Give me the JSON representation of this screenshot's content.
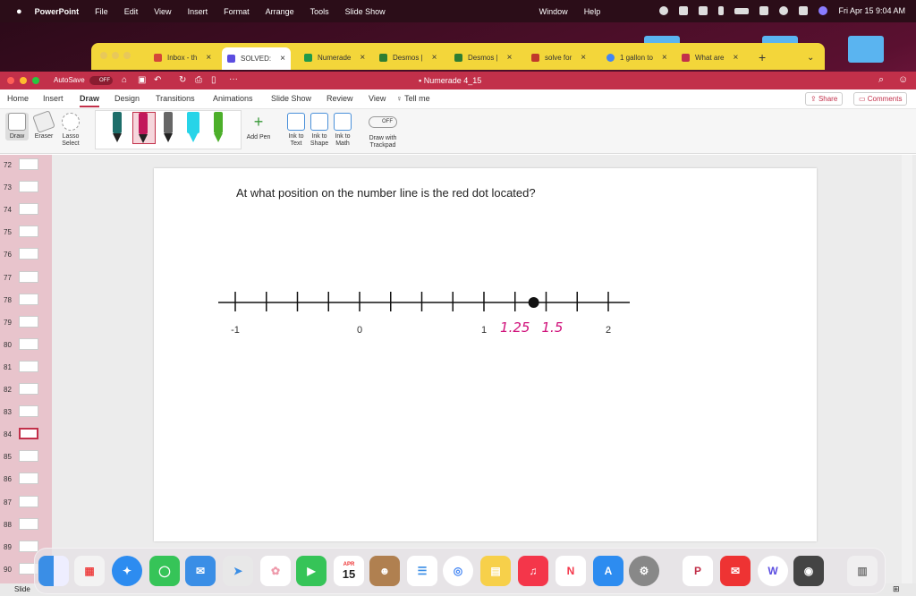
{
  "menubar": {
    "apple": "",
    "app": "PowerPoint",
    "items": [
      "File",
      "Edit",
      "View",
      "Insert",
      "Format",
      "Arrange",
      "Tools",
      "Slide Show"
    ],
    "window": "Window",
    "help": "Help",
    "datetime": "Fri Apr 15  9:04 AM"
  },
  "browser_tabs": [
    {
      "label": "Inbox - th",
      "color": "#d44638"
    },
    {
      "label": "SOLVED: ",
      "color": "#5b4de0",
      "active": true
    },
    {
      "label": "Numerade",
      "color": "#1f9a4a"
    },
    {
      "label": "Desmos |",
      "color": "#2e7d32"
    },
    {
      "label": "Desmos |",
      "color": "#2e7d32"
    },
    {
      "label": "solve for",
      "color": "#c0392b"
    },
    {
      "label": "1 gallon to",
      "color": "#4285f4"
    },
    {
      "label": "What are",
      "color": "#c2304a"
    }
  ],
  "ppt": {
    "autosave": "AutoSave",
    "autosave_state": "OFF",
    "doc_title": "Numerade 4_15",
    "tabs": [
      "Home",
      "Insert",
      "Draw",
      "Design",
      "Transitions",
      "Animations",
      "Slide Show",
      "Review",
      "View"
    ],
    "tell_me": "Tell me",
    "share": "Share",
    "comments": "Comments",
    "tools": {
      "draw": "Draw",
      "eraser": "Eraser",
      "lasso": "Lasso Select",
      "add_pen": "Add Pen",
      "ink_to_text": "Ink to Text",
      "ink_to_shape": "Ink to Shape",
      "ink_to_math": "Ink to Math",
      "draw_trackpad": "Draw with Trackpad",
      "trackpad_state": "OFF"
    },
    "pens": [
      {
        "color": "#1d6e6a"
      },
      {
        "color": "#c2185b"
      },
      {
        "color": "#666666"
      },
      {
        "color": "#27d4e8"
      },
      {
        "color": "#4caf2a"
      }
    ],
    "slides": [
      {
        "num": "72"
      },
      {
        "num": "73"
      },
      {
        "num": "74"
      },
      {
        "num": "75"
      },
      {
        "num": "76"
      },
      {
        "num": "77"
      },
      {
        "num": "78"
      },
      {
        "num": "79"
      },
      {
        "num": "80"
      },
      {
        "num": "81"
      },
      {
        "num": "82"
      },
      {
        "num": "83"
      },
      {
        "num": "84",
        "selected": true
      },
      {
        "num": "85"
      },
      {
        "num": "86"
      },
      {
        "num": "87"
      },
      {
        "num": "88"
      },
      {
        "num": "89"
      },
      {
        "num": "90"
      }
    ],
    "status": "Slide"
  },
  "slide": {
    "question": "At what position on the number line is the red dot located?",
    "number_line": {
      "labels": [
        {
          "text": "-1",
          "value": -1
        },
        {
          "text": "0",
          "value": 0
        },
        {
          "text": "1",
          "value": 1
        },
        {
          "text": "2",
          "value": 2
        }
      ],
      "tick_values": [
        -1,
        -0.75,
        -0.5,
        -0.25,
        0,
        0.25,
        0.5,
        0.75,
        1,
        1.25,
        1.5,
        1.75,
        2
      ],
      "dot_value": 1.4,
      "dot_color": "#111111",
      "handwritten": [
        {
          "text": "1.25",
          "value": 1.25,
          "color": "#d0107a"
        },
        {
          "text": "1.5",
          "value": 1.55,
          "color": "#d0107a"
        }
      ]
    }
  },
  "dock": {
    "calendar_month": "APR",
    "calendar_day": "15"
  }
}
